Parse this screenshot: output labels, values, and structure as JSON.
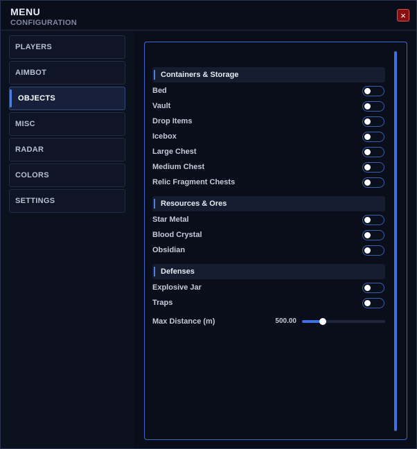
{
  "header": {
    "title": "MENU",
    "subtitle": "CONFIGURATION",
    "close_label": "×"
  },
  "sidebar": {
    "tabs": [
      {
        "label": "PLAYERS",
        "active": false
      },
      {
        "label": "AIMBOT",
        "active": false
      },
      {
        "label": "OBJECTS",
        "active": true
      },
      {
        "label": "MISC",
        "active": false
      },
      {
        "label": "RADAR",
        "active": false
      },
      {
        "label": "COLORS",
        "active": false
      },
      {
        "label": "SETTINGS",
        "active": false
      }
    ]
  },
  "content": {
    "sections": [
      {
        "title": "Containers & Storage",
        "items": [
          {
            "label": "Bed",
            "enabled": false
          },
          {
            "label": "Vault",
            "enabled": false
          },
          {
            "label": "Drop Items",
            "enabled": false
          },
          {
            "label": "Icebox",
            "enabled": false
          },
          {
            "label": "Large Chest",
            "enabled": false
          },
          {
            "label": "Medium Chest",
            "enabled": false
          },
          {
            "label": "Relic Fragment Chests",
            "enabled": false
          }
        ]
      },
      {
        "title": "Resources & Ores",
        "items": [
          {
            "label": "Star Metal",
            "enabled": false
          },
          {
            "label": "Blood Crystal",
            "enabled": false
          },
          {
            "label": "Obsidian",
            "enabled": false
          }
        ]
      },
      {
        "title": "Defenses",
        "items": [
          {
            "label": "Explosive Jar",
            "enabled": false
          },
          {
            "label": "Traps",
            "enabled": false
          }
        ]
      }
    ],
    "slider": {
      "label": "Max Distance (m)",
      "value_text": "500.00",
      "fraction": 0.25
    }
  },
  "colors": {
    "accent": "#3d73e0",
    "close_bg": "#8a1010"
  }
}
